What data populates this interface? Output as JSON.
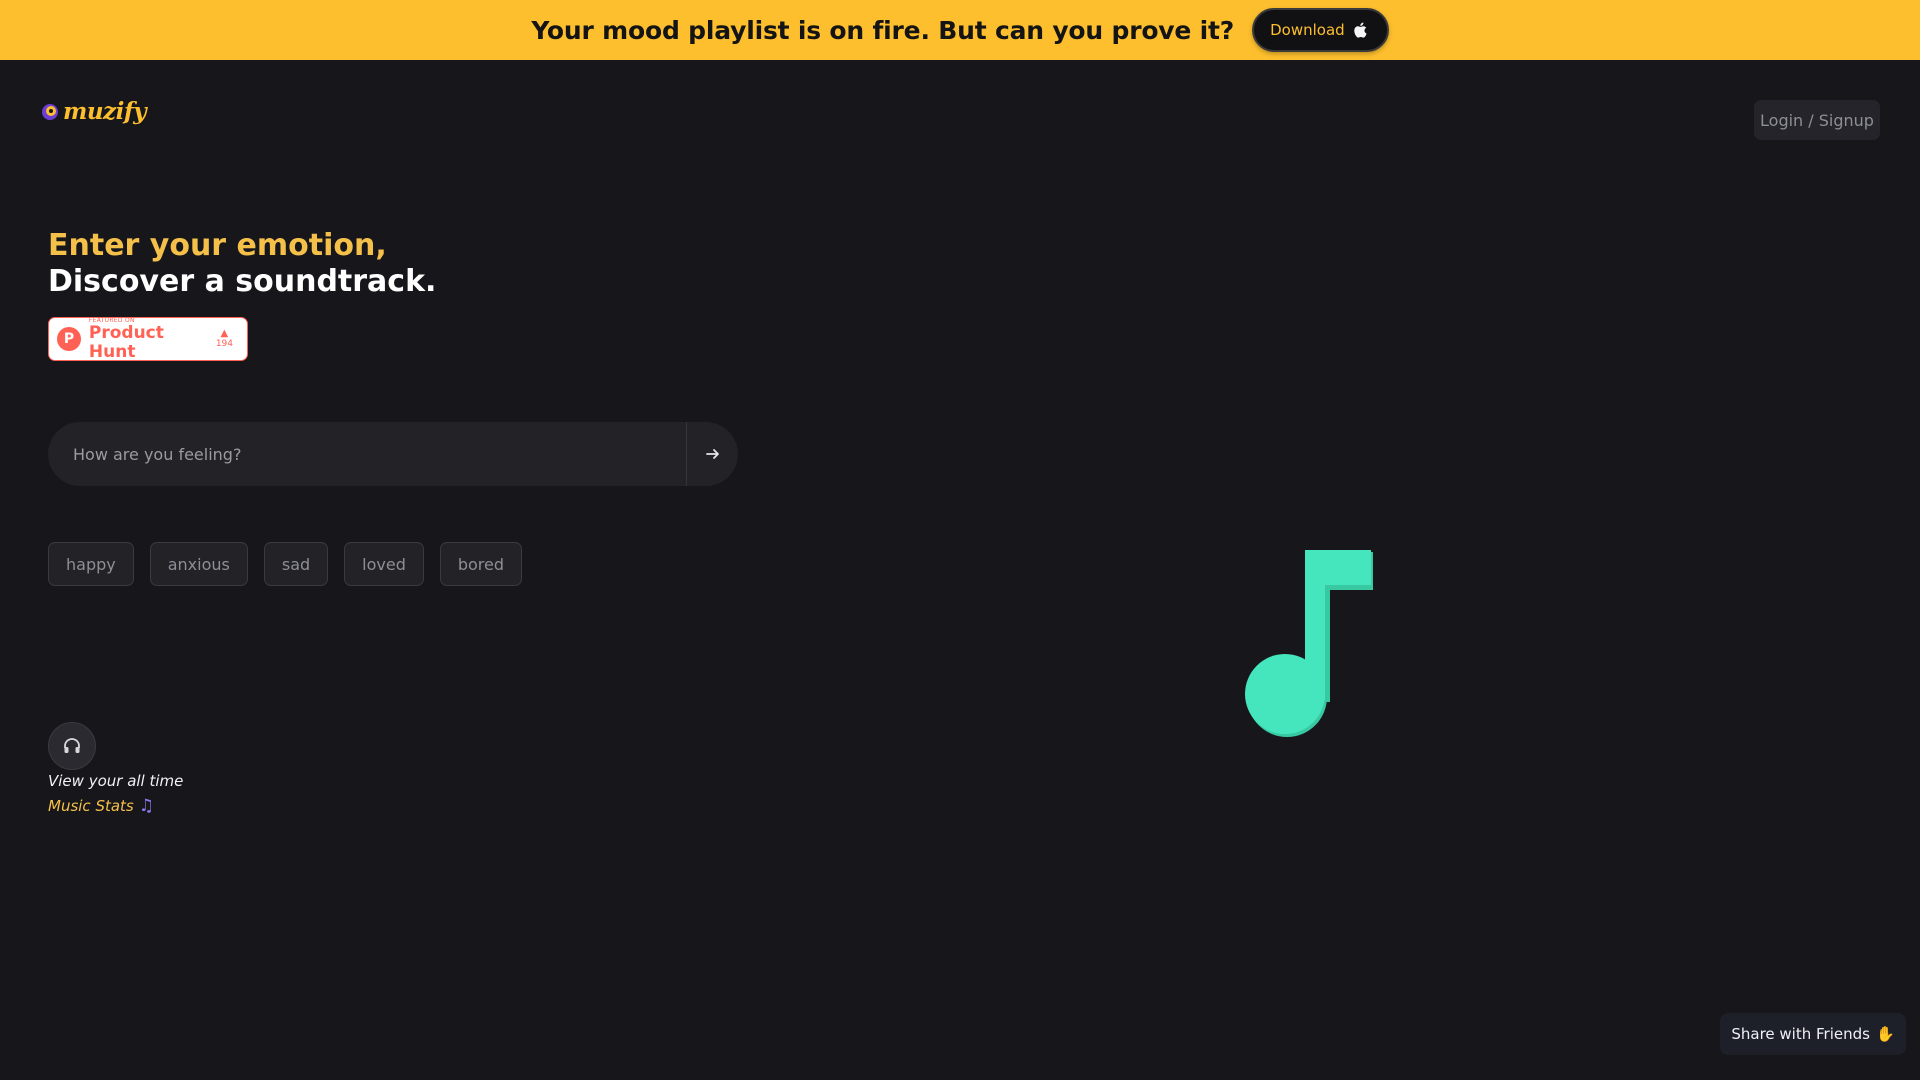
{
  "banner": {
    "text": "Your mood playlist is on fire. But can you prove it?",
    "download_label": "Download",
    "download_icon": "apple-icon"
  },
  "header": {
    "logo_text": "muzify",
    "login_label": "Login / Signup"
  },
  "hero": {
    "line1": "Enter your emotion,",
    "line2": "Discover a soundtrack."
  },
  "product_hunt": {
    "featured": "FEATURED ON",
    "name": "Product Hunt",
    "votes": "194"
  },
  "search": {
    "placeholder": "How are you feeling?",
    "submit_icon": "arrow-right-icon"
  },
  "moods": [
    "happy",
    "anxious",
    "sad",
    "loved",
    "bored"
  ],
  "stats": {
    "icon": "headphones-icon",
    "line1": "View your all time",
    "line2": "Music Stats"
  },
  "share": {
    "label": "Share with Friends"
  },
  "colors": {
    "banner_bg": "#fdbf2d",
    "page_bg": "#16161b",
    "accent_yellow": "#f4c04a",
    "note_teal": "#40e0b8",
    "product_hunt": "#ff6154"
  }
}
